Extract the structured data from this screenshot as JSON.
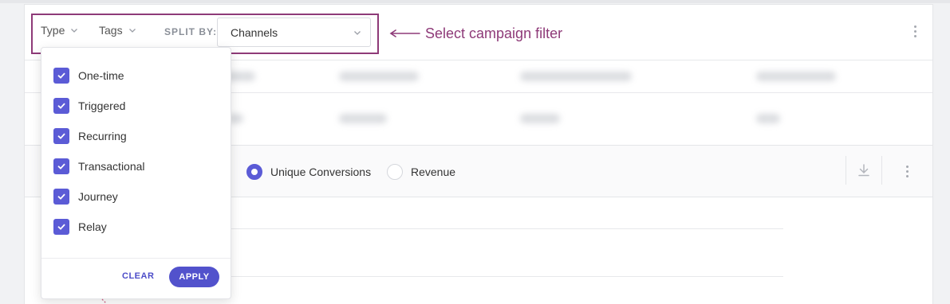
{
  "filters": {
    "type_label": "Type",
    "tags_label": "Tags",
    "split_by_label": "SPLIT BY:",
    "split_by_value": "Channels"
  },
  "annotation": {
    "text": "Select campaign filter",
    "color": "#8e3a78"
  },
  "type_dropdown": {
    "options": [
      {
        "label": "One-time",
        "checked": true
      },
      {
        "label": "Triggered",
        "checked": true
      },
      {
        "label": "Recurring",
        "checked": true
      },
      {
        "label": "Transactional",
        "checked": true
      },
      {
        "label": "Journey",
        "checked": true
      },
      {
        "label": "Relay",
        "checked": true
      }
    ],
    "clear_label": "CLEAR",
    "apply_label": "APPLY"
  },
  "metric_options": [
    {
      "label": "Unique Conversions",
      "selected": true
    },
    {
      "label": "Revenue",
      "selected": false
    }
  ],
  "colors": {
    "accent": "#5b5bd6",
    "apply_button": "#5252cc",
    "highlight_border": "#8e3a78"
  },
  "icons": {
    "chevron": "chevron-down-icon",
    "check": "check-icon",
    "download": "download-icon",
    "more": "more-vertical-icon",
    "arrow": "arrow-left-icon"
  }
}
